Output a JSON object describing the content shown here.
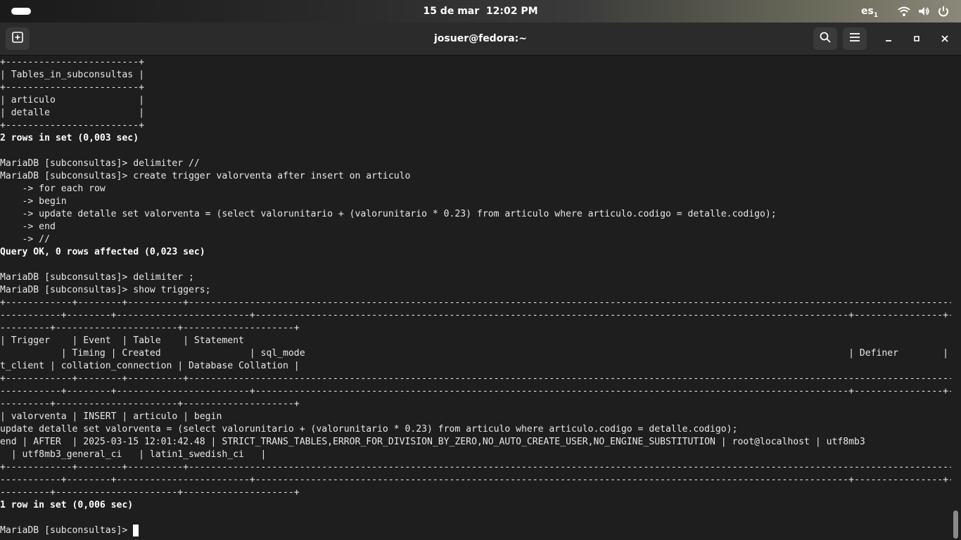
{
  "system_bar": {
    "date": "15 de mar",
    "time": "12:02 PM",
    "keyboard_layout": "es",
    "keyboard_layout_index": "1"
  },
  "window": {
    "title": "josuer@fedora:~"
  },
  "terminal": {
    "lines": [
      {
        "text": "+------------------------+",
        "bold": false
      },
      {
        "text": "| Tables_in_subconsultas |",
        "bold": false
      },
      {
        "text": "+------------------------+",
        "bold": false
      },
      {
        "text": "| articulo               |",
        "bold": false
      },
      {
        "text": "| detalle                |",
        "bold": false
      },
      {
        "text": "+------------------------+",
        "bold": false
      },
      {
        "text": "2 rows in set (0,003 sec)",
        "bold": true
      },
      {
        "text": "",
        "bold": false
      },
      {
        "text": "MariaDB [subconsultas]> delimiter //",
        "bold": false
      },
      {
        "text": "MariaDB [subconsultas]> create trigger valorventa after insert on articulo",
        "bold": false
      },
      {
        "text": "    -> for each row",
        "bold": false
      },
      {
        "text": "    -> begin",
        "bold": false
      },
      {
        "text": "    -> update detalle set valorventa = (select valorunitario + (valorunitario * 0.23) from articulo where articulo.codigo = detalle.codigo);",
        "bold": false
      },
      {
        "text": "    -> end",
        "bold": false
      },
      {
        "text": "    -> //",
        "bold": false
      },
      {
        "text": "Query OK, 0 rows affected (0,023 sec)",
        "bold": true
      },
      {
        "text": "",
        "bold": false
      },
      {
        "text": "MariaDB [subconsultas]> delimiter ;",
        "bold": false
      },
      {
        "text": "MariaDB [subconsultas]> show triggers;",
        "bold": false
      },
      {
        "text": "+------------+--------+----------+------------------------------------------------------------------------------------------------------------------------------------------+",
        "bold": false
      },
      {
        "text": "-----------+--------+------------------------+-----------------------------------------------------------------------------------------------------------+----------------+------------",
        "bold": false
      },
      {
        "text": "---------+----------------------+--------------------+",
        "bold": false
      },
      {
        "text": "| Trigger    | Event  | Table    | Statement",
        "bold": false
      },
      {
        "text": "           | Timing | Created                | sql_mode                                                                                                  | Definer        | character_se",
        "bold": false
      },
      {
        "text": "t_client | collation_connection | Database Collation |",
        "bold": false
      },
      {
        "text": "+------------+--------+----------+------------------------------------------------------------------------------------------------------------------------------------------+",
        "bold": false
      },
      {
        "text": "-----------+--------+------------------------+-----------------------------------------------------------------------------------------------------------+----------------+------------",
        "bold": false
      },
      {
        "text": "---------+----------------------+--------------------+",
        "bold": false
      },
      {
        "text": "| valorventa | INSERT | articulo | begin",
        "bold": false
      },
      {
        "text": "update detalle set valorventa = (select valorunitario + (valorunitario * 0.23) from articulo where articulo.codigo = detalle.codigo);",
        "bold": false
      },
      {
        "text": "end | AFTER  | 2025-03-15 12:01:42.48 | STRICT_TRANS_TABLES,ERROR_FOR_DIVISION_BY_ZERO,NO_AUTO_CREATE_USER,NO_ENGINE_SUBSTITUTION | root@localhost | utf8mb3",
        "bold": false
      },
      {
        "text": "  | utf8mb3_general_ci   | latin1_swedish_ci   |",
        "bold": false
      },
      {
        "text": "+------------+--------+----------+------------------------------------------------------------------------------------------------------------------------------------------+",
        "bold": false
      },
      {
        "text": "-----------+--------+------------------------+-----------------------------------------------------------------------------------------------------------+----------------+------------",
        "bold": false
      },
      {
        "text": "---------+----------------------+--------------------+",
        "bold": false
      },
      {
        "text": "1 row in set (0,006 sec)",
        "bold": true
      },
      {
        "text": "",
        "bold": false
      }
    ],
    "prompt": "MariaDB [subconsultas]> "
  },
  "icons": {
    "new_tab": "new-tab-icon",
    "search": "search-icon",
    "menu": "hamburger-menu-icon",
    "minimize": "minimize-icon",
    "maximize": "maximize-icon",
    "close": "close-icon",
    "wifi": "wifi-icon",
    "volume": "volume-icon",
    "power": "power-icon"
  }
}
